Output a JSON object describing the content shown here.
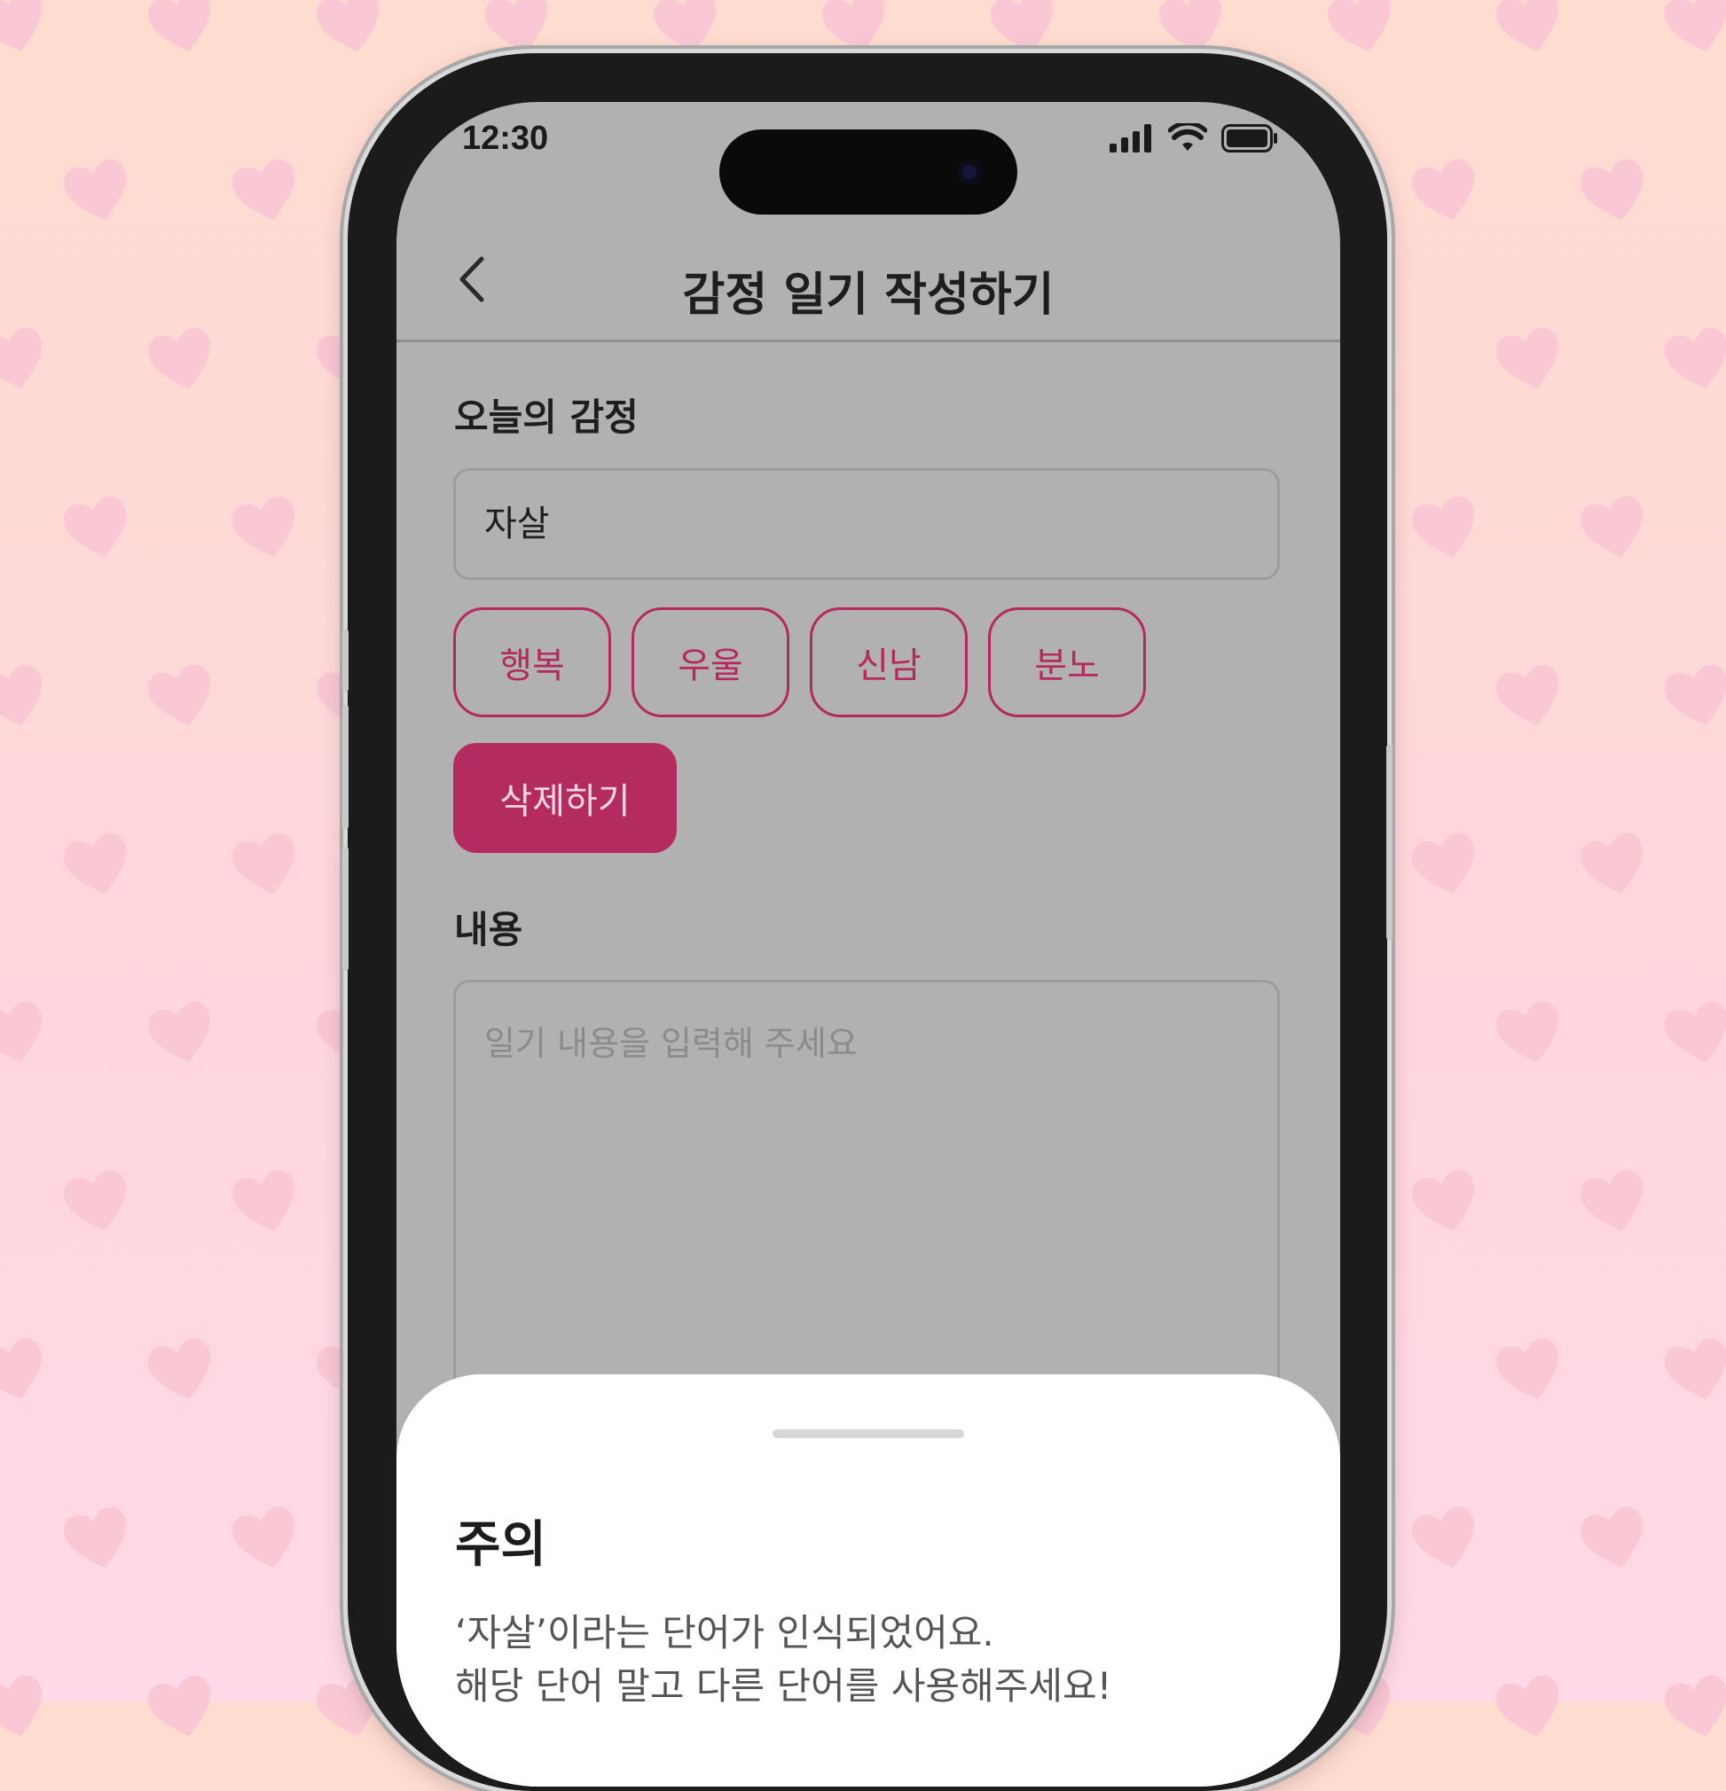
{
  "colors": {
    "accent": "#b42c5f",
    "chip_text": "#b5295e",
    "screen_dim": "#b1b1b1",
    "heart": "#f9c8d4"
  },
  "status_bar": {
    "time": "12:30",
    "icons": [
      "cellular-signal-icon",
      "wifi-icon",
      "battery-icon"
    ]
  },
  "nav": {
    "back_icon": "chevron-left-icon",
    "title": "감정 일기 작성하기"
  },
  "emotion_section": {
    "label": "오늘의 감정",
    "input_value": "자살",
    "chips": [
      "행복",
      "우울",
      "신남",
      "분노"
    ],
    "delete_label": "삭제하기"
  },
  "content_section": {
    "label": "내용",
    "placeholder": "일기 내용을 입력해 주세요"
  },
  "bottom_sheet": {
    "title": "주의",
    "message_line1": "‘자살’이라는 단어가 인식되었어요.",
    "message_line2": "해당 단어 말고 다른 단어를 사용해주세요!"
  }
}
